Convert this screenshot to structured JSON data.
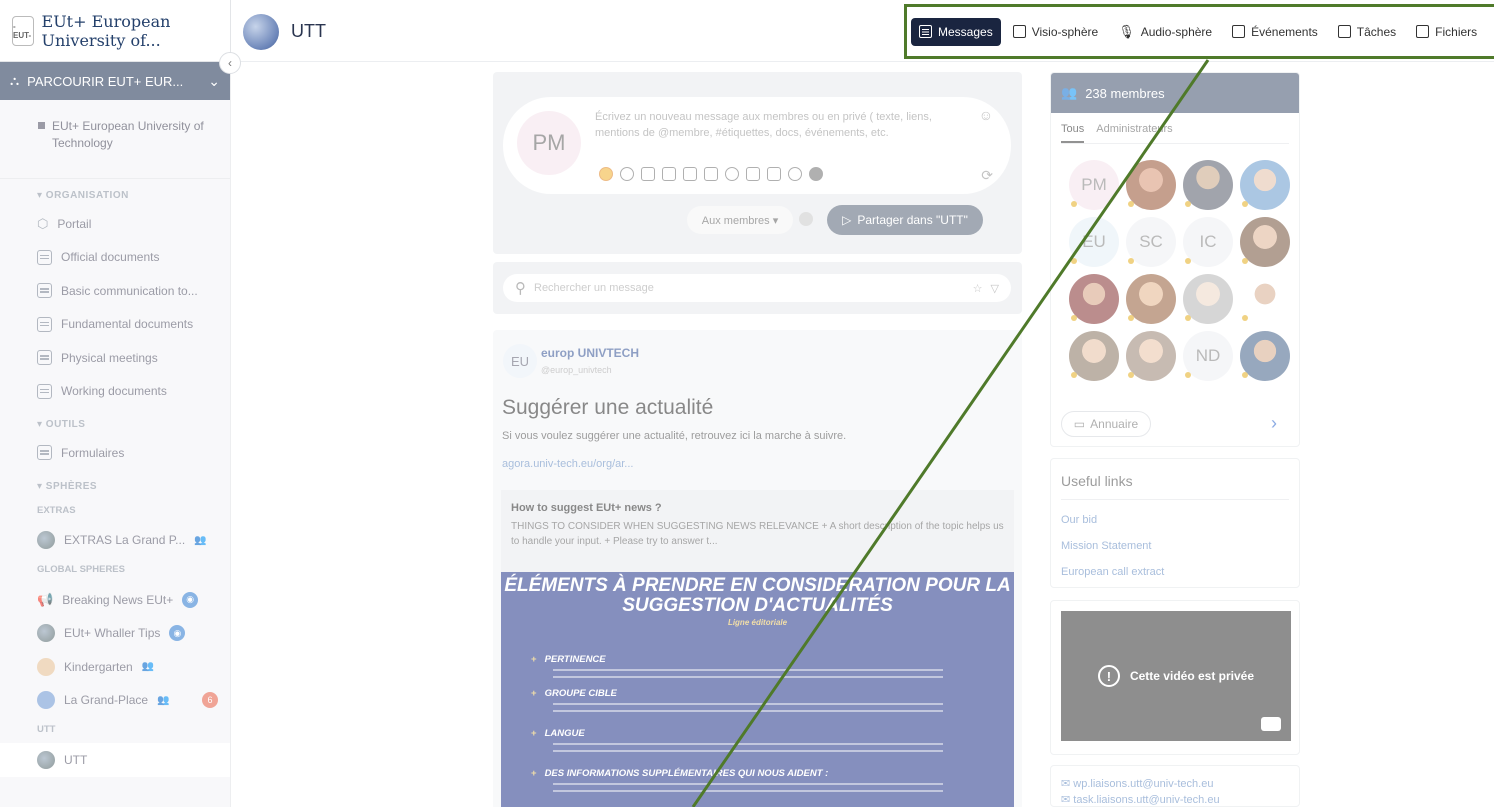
{
  "sidebar": {
    "org_logo_text": "-EUT-",
    "org_name": "EUt+ European University of...",
    "collapse_icon": "chevron-left-icon",
    "browse_label": "PARCOURIR EUT+ EUR...",
    "org_item": "EUt+ European University of Technology",
    "section_organisation": "▾ ORGANISATION",
    "organisation_items": [
      {
        "label": "Portail",
        "icon": "portal-icon"
      },
      {
        "label": "Official documents",
        "icon": "document-icon"
      },
      {
        "label": "Basic communication to...",
        "icon": "document-icon"
      },
      {
        "label": "Fundamental documents",
        "icon": "document-icon"
      },
      {
        "label": "Physical meetings",
        "icon": "document-icon"
      },
      {
        "label": "Working documents",
        "icon": "document-icon"
      }
    ],
    "section_outils": "▾ OUTILS",
    "outils_items": [
      {
        "label": "Formulaires",
        "icon": "form-icon"
      }
    ],
    "section_spheres": "▾ SPHÈRES",
    "group_extras": "EXTRAS",
    "extras_items": [
      {
        "label": "EXTRAS La Grand P..."
      }
    ],
    "group_global": "GLOBAL SPHERES",
    "global_items": [
      {
        "label": "Breaking News EUt+"
      },
      {
        "label": "EUt+ Whaller Tips"
      },
      {
        "label": "Kindergarten"
      },
      {
        "label": "La Grand-Place",
        "badge": "6"
      }
    ],
    "group_utt": "UTT",
    "utt_items": [
      {
        "label": "UTT"
      }
    ]
  },
  "topbar": {
    "space_title": "UTT",
    "tabs": [
      {
        "label": "Messages",
        "active": true,
        "icon": "messages-icon"
      },
      {
        "label": "Visio-sphère",
        "icon": "video-icon"
      },
      {
        "label": "Audio-sphère",
        "icon": "microphone-icon"
      },
      {
        "label": "Événements",
        "icon": "calendar-icon"
      },
      {
        "label": "Tâches",
        "icon": "tasks-icon"
      },
      {
        "label": "Fichiers",
        "icon": "files-icon"
      }
    ]
  },
  "composer": {
    "avatar_initials": "PM",
    "placeholder": "Écrivez un nouveau message aux membres ou en privé ( texte, liens, mentions de @membre, #étiquettes, docs, événements, etc.",
    "audience_label": "Aux membres ▾",
    "share_label": "Partager dans \"UTT\""
  },
  "search": {
    "placeholder": "Rechercher un message"
  },
  "post": {
    "avatar_initials": "EU",
    "author": "europ UNIVTECH",
    "handle": "@europ_univtech",
    "title": "Suggérer une actualité",
    "text": "Si vous voulez suggérer une actualité, retrouvez ici la marche à suivre.",
    "link": "agora.univ-tech.eu/org/ar...",
    "preview_title": "How to suggest EUt+ news ?",
    "preview_text": "THINGS TO CONSIDER WHEN SUGGESTING NEWS   RELEVANCE + A short description of the topic helps us to handle your input. + Please try to answer t...",
    "banner_title": "ÉLÉMENTS À PRENDRE EN CONSIDERATION POUR LA SUGGESTION D'ACTUALITÉS",
    "banner_sub": "Ligne éditoriale",
    "banner_items": [
      "PERTINENCE",
      "GROUPE CIBLE",
      "LANGUE",
      "DES INFORMATIONS SUPPLÉMENTAIRES QUI NOUS AIDENT :"
    ]
  },
  "members": {
    "count_label": "238 membres",
    "tab_all": "Tous",
    "tab_admins": "Administrateurs",
    "avatars": [
      "PM",
      "",
      "",
      "",
      "EU",
      "SC",
      "IC",
      "",
      "",
      "",
      "",
      "",
      "",
      "",
      "ND",
      ""
    ],
    "directory_label": "Annuaire"
  },
  "useful_links": {
    "title": "Useful links",
    "items": [
      "Our bid",
      "Mission Statement",
      "European call extract"
    ]
  },
  "video": {
    "message": "Cette vidéo est privée"
  },
  "contacts": {
    "emails": [
      "wp.liaisons.utt@univ-tech.eu",
      "task.liaisons.utt@univ-tech.eu"
    ]
  },
  "colors": {
    "accent_dark": "#1a2540",
    "highlight_border": "#4f7a2a",
    "sidebar_bar": "#3d4e6b"
  }
}
